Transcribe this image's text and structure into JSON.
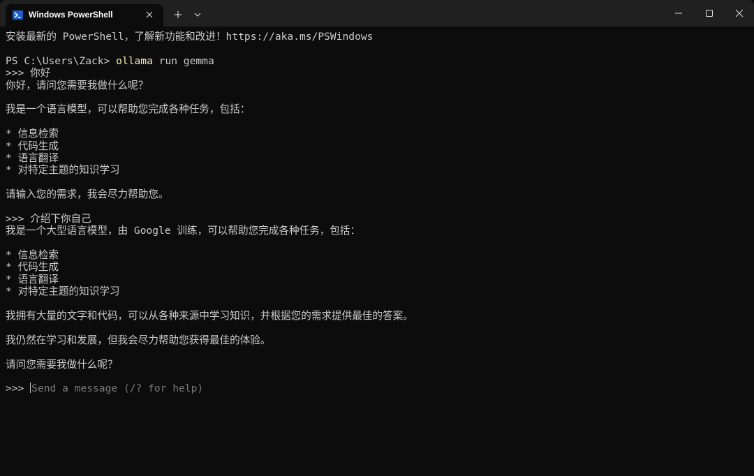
{
  "window": {
    "tab_title": "Windows PowerShell"
  },
  "colors": {
    "background": "#0c0c0c",
    "titlebar": "#202020",
    "text": "#cccccc",
    "command": "#f9f1a5",
    "placeholder": "#7a7a7a",
    "icon_blue": "#1f5fc7"
  },
  "icons": {
    "tab": "powershell-icon",
    "tab_close": "close-icon",
    "new_tab": "plus-icon",
    "dropdown": "chevron-down-icon",
    "minimize": "minimize-icon",
    "maximize": "maximize-icon",
    "close": "close-icon"
  },
  "terminal": {
    "banner": "安装最新的 PowerShell，了解新功能和改进！https://aka.ms/PSWindows",
    "prompt": "PS C:\\Users\\Zack> ",
    "command_name": "ollama",
    "command_args": " run gemma",
    "lines_1": [
      ">>> 你好",
      "你好，请问您需要我做什么呢？",
      "",
      "我是一个语言模型，可以帮助您完成各种任务，包括：",
      "",
      "* 信息检索",
      "* 代码生成",
      "* 语言翻译",
      "* 对特定主题的知识学习",
      "",
      "请输入您的需求，我会尽力帮助您。",
      "",
      ">>> 介绍下你自己",
      "我是一个大型语言模型，由 Google 训练，可以帮助您完成各种任务，包括：",
      "",
      "* 信息检索",
      "* 代码生成",
      "* 语言翻译",
      "* 对特定主题的知识学习",
      "",
      "我拥有大量的文字和代码，可以从各种来源中学习知识，并根据您的需求提供最佳的答案。",
      "",
      "我仍然在学习和发展，但我会尽力帮助您获得最佳的体验。",
      "",
      "请问您需要我做什么呢？",
      ""
    ],
    "input_prompt": ">>> ",
    "input_placeholder": "Send a message (/? for help)"
  }
}
